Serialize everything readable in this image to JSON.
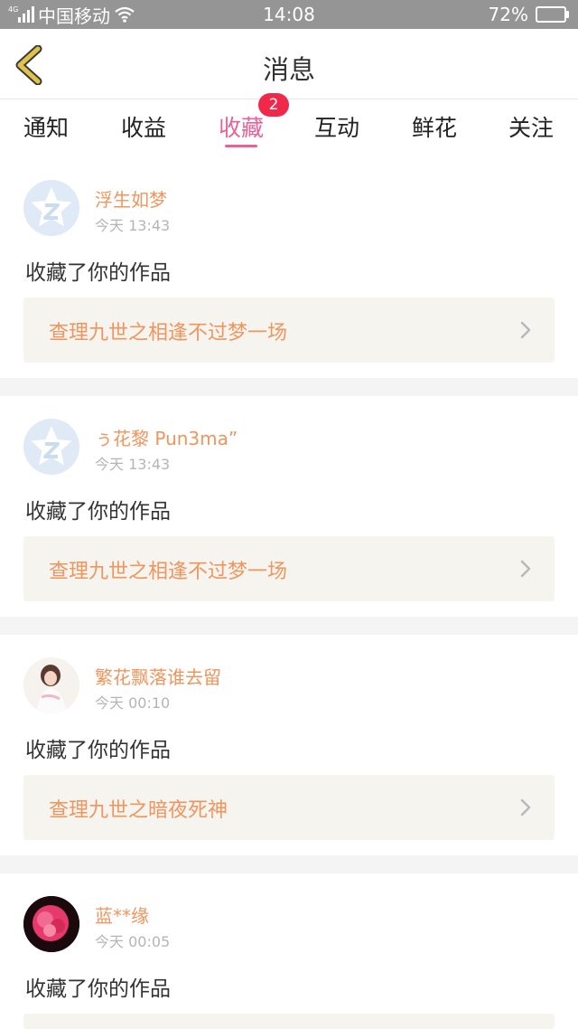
{
  "status_bar": {
    "network_tag": "4G",
    "carrier": "中国移动",
    "time": "14:08",
    "battery": "72%",
    "battery_level": 0.72
  },
  "header": {
    "title": "消息"
  },
  "tabs": [
    {
      "label": "通知"
    },
    {
      "label": "收益"
    },
    {
      "label": "收藏",
      "active": true,
      "badge": "2"
    },
    {
      "label": "互动"
    },
    {
      "label": "鲜花"
    },
    {
      "label": "关注"
    }
  ],
  "feed": [
    {
      "user": "浮生如梦",
      "time": "今天 13:43",
      "action": "收藏了你的作品",
      "work": "查理九世之相逢不过梦一场",
      "avatar": "default-star-avatar"
    },
    {
      "user": "ぅ花黎 Pun3ma”",
      "time": "今天 13:43",
      "action": "收藏了你的作品",
      "work": "查理九世之相逢不过梦一场",
      "avatar": "default-star-avatar"
    },
    {
      "user": "繁花飘落谁去留",
      "time": "今天 00:10",
      "action": "收藏了你的作品",
      "work": "查理九世之暗夜死神",
      "avatar": "photo-avatar"
    },
    {
      "user": "蓝**缘",
      "time": "今天 00:05",
      "action": "收藏了你的作品",
      "work": "",
      "avatar": "photo-avatar"
    }
  ],
  "colors": {
    "accent": "#e8619a",
    "name_orange": "#f0955e",
    "badge_red": "#f0294a",
    "link_bg": "#f5f4ef",
    "back_arrow": "#e3c24a"
  }
}
